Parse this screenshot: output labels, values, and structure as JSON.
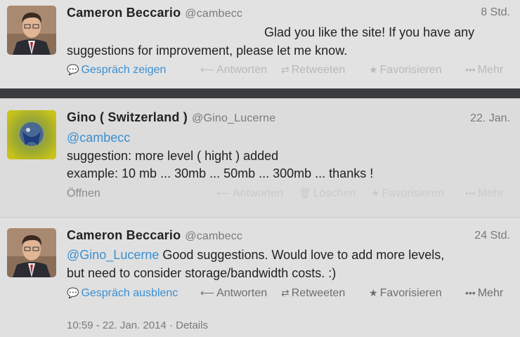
{
  "tweets": [
    {
      "name": "Cameron Beccario",
      "handle": "@cambecc",
      "time": "8 Std.",
      "line1": "Glad you like the site! If you have any",
      "line2": "suggestions for improvement, please let me know.",
      "actions": {
        "conversation": "Gespräch zeigen",
        "reply": "Antworten",
        "retweet": "Retweeten",
        "favorite": "Favorisieren",
        "more": "Mehr"
      }
    },
    {
      "name": "Gino ( Switzerland )",
      "handle": "@Gino_Lucerne",
      "time": "22. Jan.",
      "mention": "@cambecc",
      "line2": "suggestion: more level ( hight ) added",
      "line3": "example: 10 mb ... 30mb ... 50mb ... 300mb ... thanks !",
      "actions": {
        "open": "Öffnen",
        "reply": "Antworten",
        "delete": "Löschen",
        "favorite": "Favorisieren",
        "more": "Mehr"
      }
    },
    {
      "name": "Cameron Beccario",
      "handle": "@cambecc",
      "time": "24 Std.",
      "mention": "@Gino_Lucerne",
      "line1_rest": " Good suggestions. Would love to add more levels,",
      "line2": "but need to consider storage/bandwidth costs. :)",
      "actions": {
        "conversation": "Gespräch ausblenc",
        "reply": "Antworten",
        "retweet": "Retweeten",
        "favorite": "Favorisieren",
        "more": "Mehr"
      },
      "meta": {
        "timestamp": "10:59 - 22. Jan. 2014",
        "separator": "·",
        "details": "Details"
      }
    }
  ],
  "icons": {
    "conversation": "speech-bubble-icon",
    "reply": "reply-arrow-icon",
    "retweet": "retweet-icon",
    "favorite": "star-icon",
    "more": "more-dots-icon",
    "delete": "trash-icon"
  },
  "colors": {
    "link": "#3b8fd0",
    "muted": "#7a7a7a",
    "divider": "#3a3d3f"
  }
}
